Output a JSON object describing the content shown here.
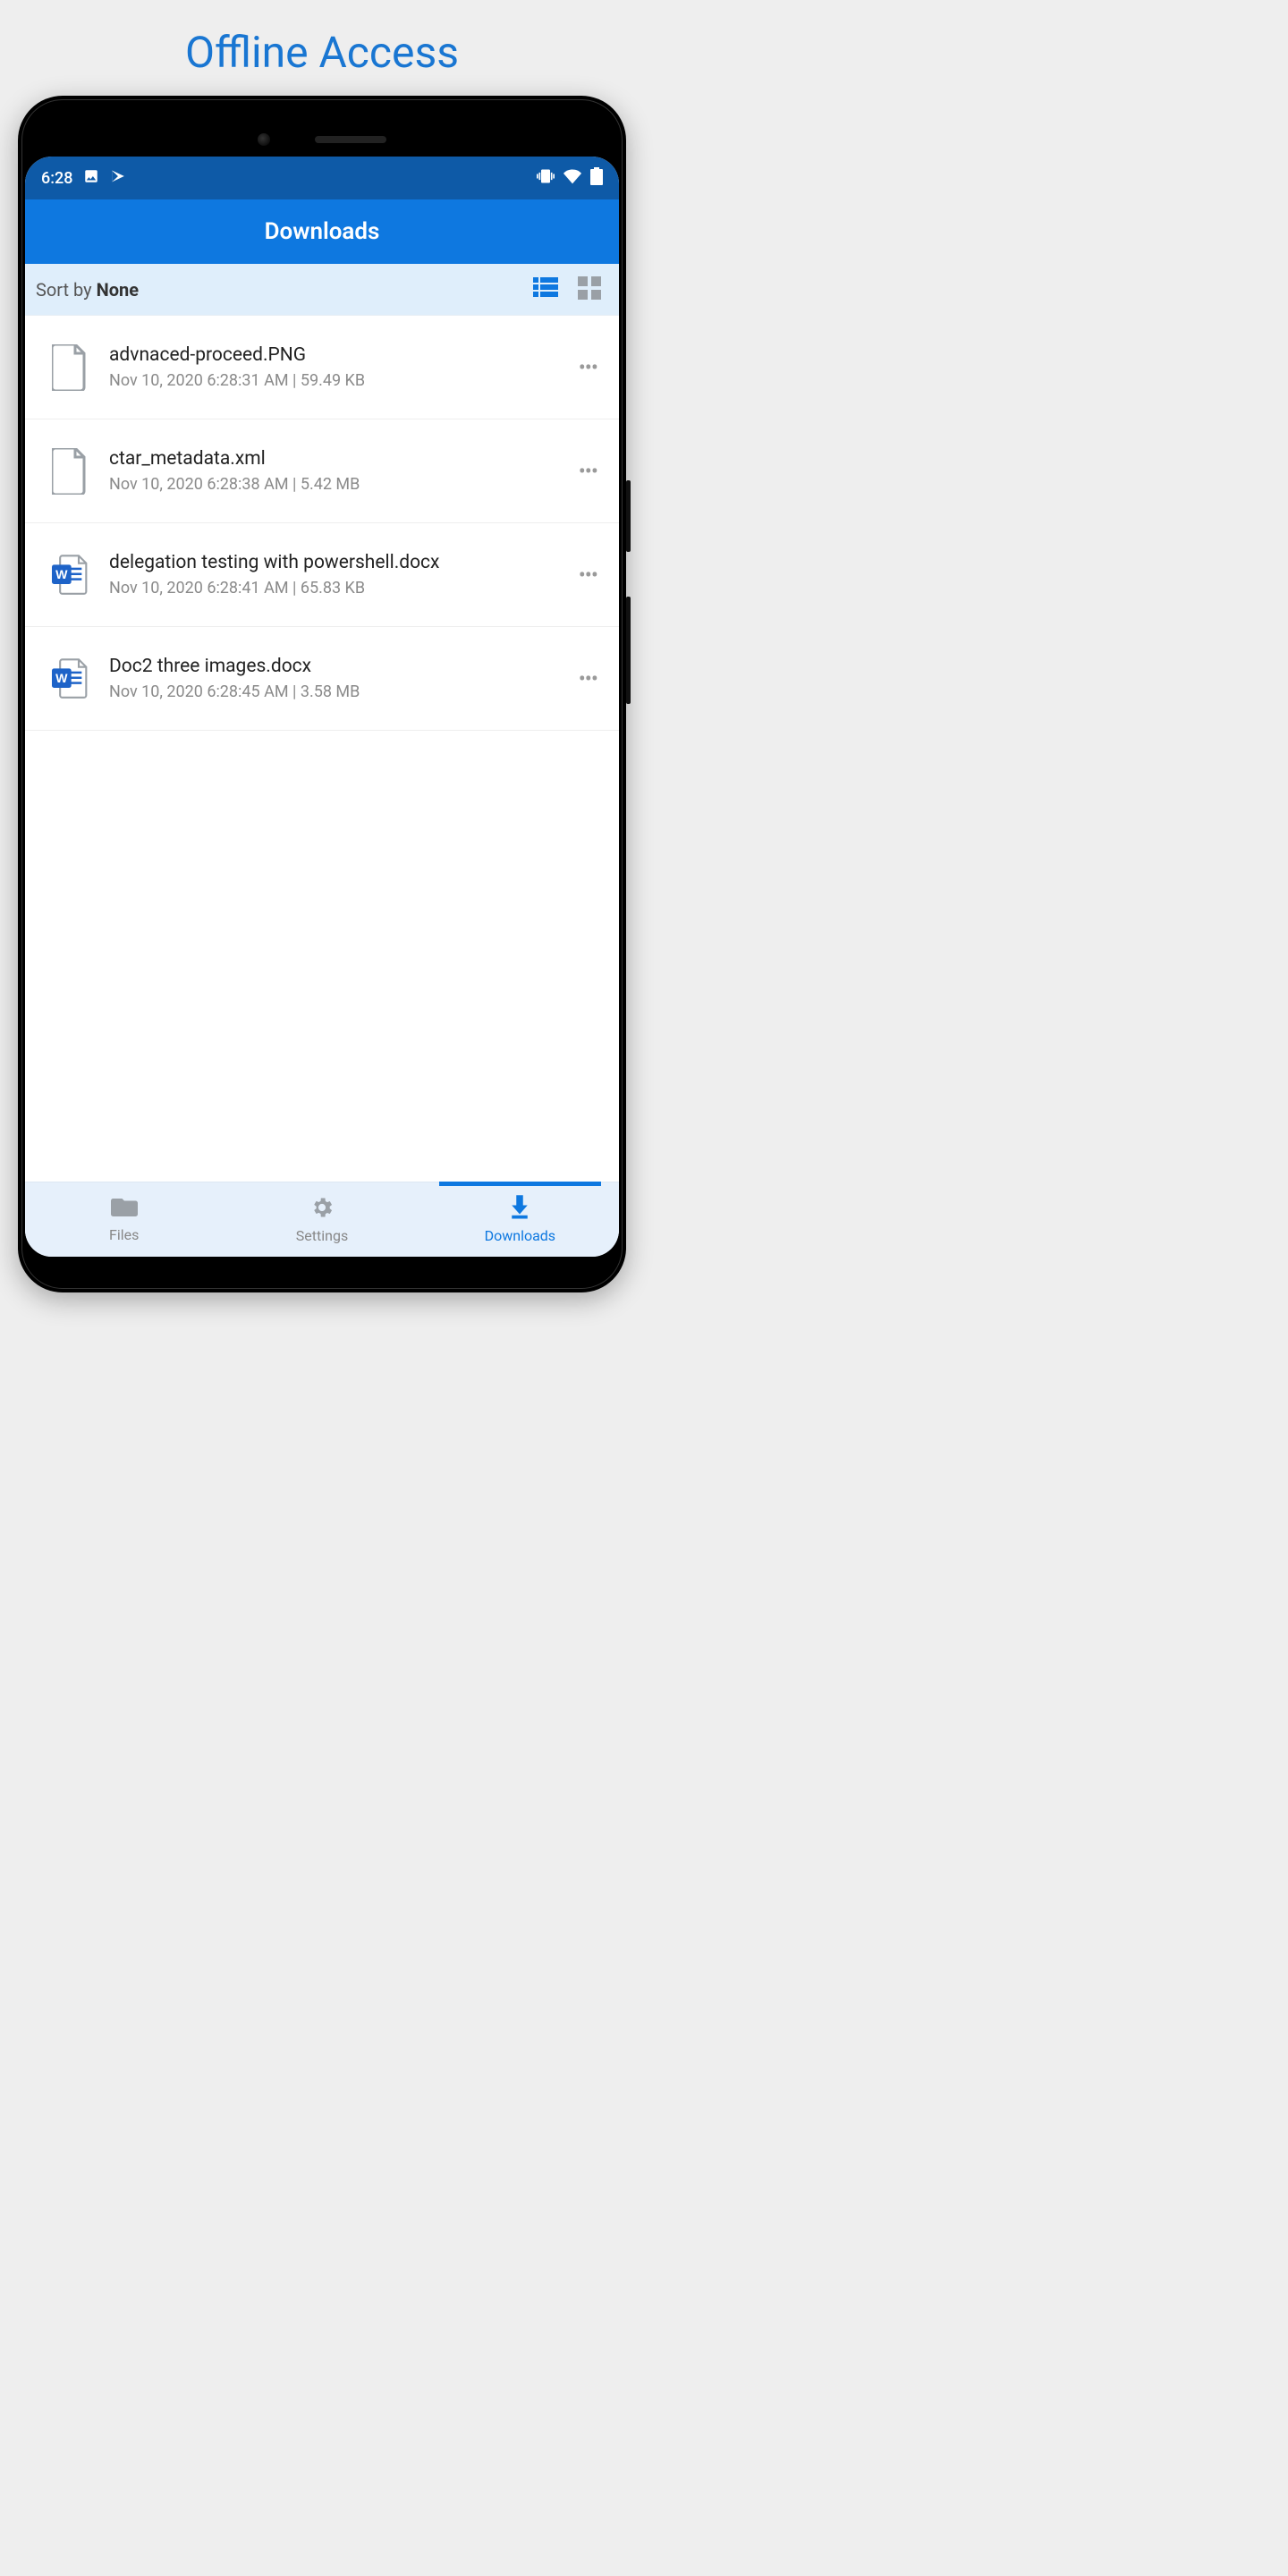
{
  "promo": {
    "title": "Offline Access"
  },
  "status": {
    "time": "6:28"
  },
  "appbar": {
    "title": "Downloads"
  },
  "sortbar": {
    "prefix": "Sort by ",
    "value": "None"
  },
  "files": [
    {
      "name": "advnaced-proceed.PNG",
      "meta": "Nov 10, 2020 6:28:31 AM | 59.49 KB",
      "icon": "file"
    },
    {
      "name": "ctar_metadata.xml",
      "meta": "Nov 10, 2020 6:28:38 AM | 5.42 MB",
      "icon": "file"
    },
    {
      "name": "delegation testing with powershell.docx",
      "meta": "Nov 10, 2020 6:28:41 AM | 65.83 KB",
      "icon": "word"
    },
    {
      "name": "Doc2 three images.docx",
      "meta": "Nov 10, 2020 6:28:45 AM | 3.58 MB",
      "icon": "word"
    }
  ],
  "nav": {
    "files": "Files",
    "settings": "Settings",
    "downloads": "Downloads"
  }
}
